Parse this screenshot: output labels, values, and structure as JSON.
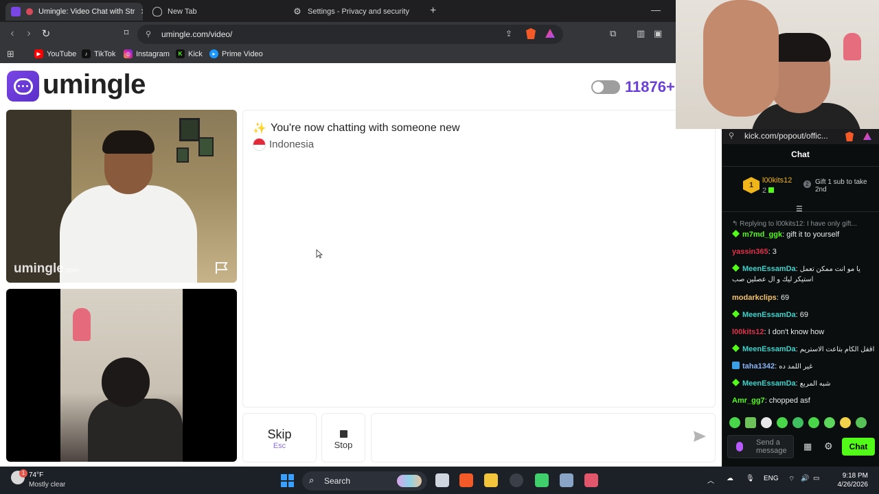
{
  "browser": {
    "tabs": [
      {
        "label": "Umingle: Video Chat with Str",
        "active": true
      },
      {
        "label": "New Tab",
        "active": false
      },
      {
        "label": "Settings - Privacy and security",
        "active": false
      }
    ],
    "address": "umingle.com/video/",
    "bookmarks": [
      {
        "label": "YouTube",
        "icon": "youtube-icon",
        "color": "#ff0000"
      },
      {
        "label": "TikTok",
        "icon": "tiktok-icon",
        "color": "#000000"
      },
      {
        "label": "Instagram",
        "icon": "instagram-icon",
        "color": "#d6249f"
      },
      {
        "label": "Kick",
        "icon": "kick-icon",
        "color": "#53fc18"
      },
      {
        "label": "Prime Video",
        "icon": "prime-video-icon",
        "color": "#1a98ff"
      }
    ]
  },
  "site": {
    "logo_text": "umingle",
    "online_count": "11876+",
    "accent_color": "#6a3fd6",
    "watermark": "umingle",
    "watermark_suffix": ".com",
    "chat_status": "You're now chatting with someone new",
    "country": "Indonesia",
    "skip_label": "Skip",
    "skip_hint": "Esc",
    "stop_label": "Stop",
    "message_placeholder": ""
  },
  "kick": {
    "url": "kick.com/popout/offic...",
    "chat_title": "Chat",
    "gifter": {
      "rank": "1",
      "name": "l00kits12",
      "count": "2"
    },
    "gift_cta": {
      "rank": "2",
      "text": "Gift 1 sub to take 2nd"
    },
    "reply_line": "Replying to l00kits12: I have only gift...",
    "messages": [
      {
        "user": "m7md_ggk",
        "text": "gift it to yourself",
        "color": "#53fc18",
        "badge": true
      },
      {
        "user": "yassin365",
        "text": "3",
        "color": "#e0324a",
        "badge": false
      },
      {
        "user": "MeenEssamDa",
        "text": "يا مو انت ممكن تعمل استيكر ليك و ال عصلين صب",
        "color": "#3fd0c9",
        "badge": true
      },
      {
        "user": "modarkclips",
        "text": "69",
        "color": "#f5c26b",
        "badge": false
      },
      {
        "user": "MeenEssamDa",
        "text": "69",
        "color": "#3fd0c9",
        "badge": true
      },
      {
        "user": "l00kits12",
        "text": "I don't know how",
        "color": "#e0324a",
        "badge": false
      },
      {
        "user": "MeenEssamDa",
        "text": "اقفل الكام بتاعت الاستريم",
        "color": "#3fd0c9",
        "badge": true
      },
      {
        "user": "taha1342",
        "text": "غير اللمد ده",
        "color": "#8ab4f8",
        "badge": "blue"
      },
      {
        "user": "MeenEssamDa",
        "text": "شبه المربع",
        "color": "#3fd0c9",
        "badge": true
      },
      {
        "user": "Amr_gg7",
        "text": "chopped asf",
        "color": "#53fc18",
        "badge": false
      }
    ],
    "input_placeholder": "Send a message",
    "chat_button": "Chat",
    "accent_color": "#53fc18"
  },
  "taskbar": {
    "weather_temp": "74°F",
    "weather_desc": "Mostly clear",
    "weather_badge": "1",
    "search_label": "Search",
    "language": "ENG",
    "time": "9:18 PM",
    "date": "4/26/2026"
  }
}
